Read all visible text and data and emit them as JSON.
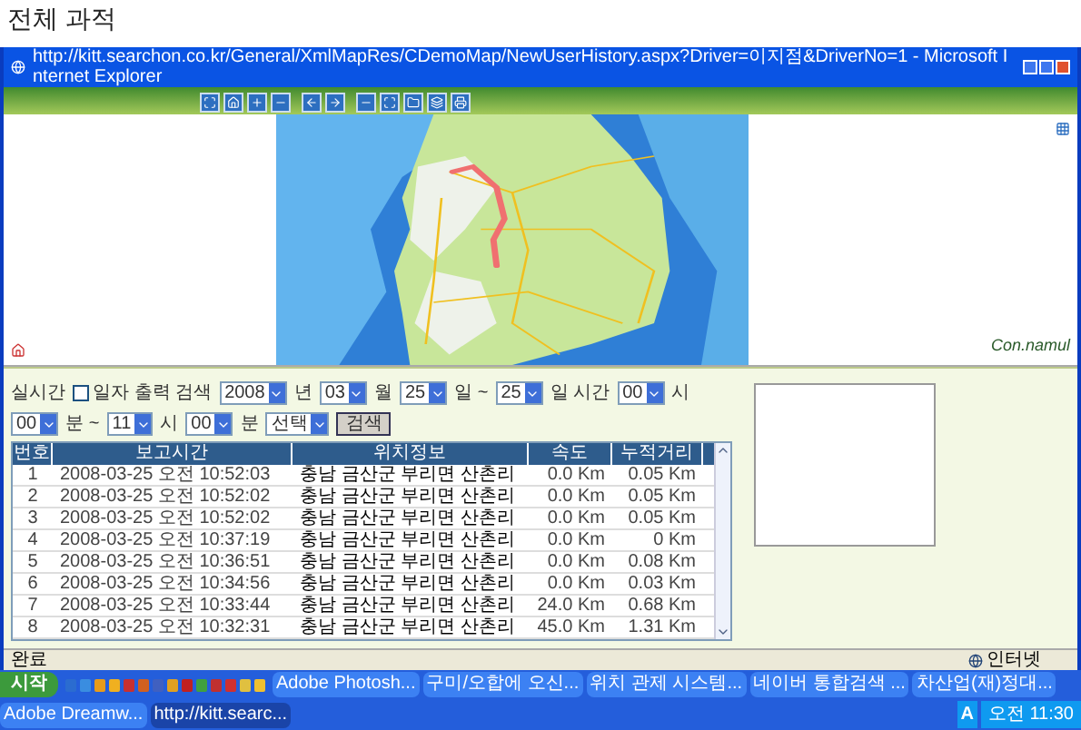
{
  "page_title": "전체 과적",
  "browser": {
    "title": "http://kitt.searchon.co.kr/General/XmlMapRes/CDemoMap/NewUserHistory.aspx?Driver=이지점&DriverNo=1 - Microsoft Internet Explorer"
  },
  "map": {
    "logo": "Con.namul"
  },
  "filter": [
    {
      "kind": "text",
      "label": "실시간"
    },
    {
      "kind": "checkbox",
      "label": "일자 출력 검색",
      "checked": false
    },
    {
      "kind": "select",
      "value": "2008"
    },
    {
      "kind": "text",
      "label": "년"
    },
    {
      "kind": "select",
      "value": "03"
    },
    {
      "kind": "text",
      "label": "월"
    },
    {
      "kind": "select",
      "value": "25"
    },
    {
      "kind": "text",
      "label": "일 ~"
    },
    {
      "kind": "select",
      "value": "25"
    },
    {
      "kind": "text",
      "label": "일 시간"
    },
    {
      "kind": "select",
      "value": "00"
    },
    {
      "kind": "text",
      "label": "시"
    },
    {
      "kind": "select",
      "value": "00"
    },
    {
      "kind": "text",
      "label": "분 ~"
    },
    {
      "kind": "select",
      "value": "11"
    },
    {
      "kind": "text",
      "label": "시"
    },
    {
      "kind": "select",
      "value": "00"
    },
    {
      "kind": "text",
      "label": "분"
    },
    {
      "kind": "select",
      "value": "선택"
    },
    {
      "kind": "button",
      "label": "검색"
    }
  ],
  "table": {
    "columns": [
      "번호",
      "보고시간",
      "위치정보",
      "속도",
      "누적거리"
    ],
    "rows": [
      [
        "1",
        "2008-03-25 오전 10:52:03",
        "충남 금산군 부리면 산촌리",
        "0.0 Km",
        "0.05 Km"
      ],
      [
        "2",
        "2008-03-25 오전 10:52:02",
        "충남 금산군 부리면 산촌리",
        "0.0 Km",
        "0.05 Km"
      ],
      [
        "3",
        "2008-03-25 오전 10:52:02",
        "충남 금산군 부리면 산촌리",
        "0.0 Km",
        "0.05 Km"
      ],
      [
        "4",
        "2008-03-25 오전 10:37:19",
        "충남 금산군 부리면 산촌리",
        "0.0 Km",
        "0 Km"
      ],
      [
        "5",
        "2008-03-25 오전 10:36:51",
        "충남 금산군 부리면 산촌리",
        "0.0 Km",
        "0.08 Km"
      ],
      [
        "6",
        "2008-03-25 오전 10:34:56",
        "충남 금산군 부리면 산촌리",
        "0.0 Km",
        "0.03 Km"
      ],
      [
        "7",
        "2008-03-25 오전 10:33:44",
        "충남 금산군 부리면 산촌리",
        "24.0 Km",
        "0.68 Km"
      ],
      [
        "8",
        "2008-03-25 오전 10:32:31",
        "충남 금산군 부리면 산촌리",
        "45.0 Km",
        "1.31 Km"
      ]
    ]
  },
  "status_bar": {
    "text": "완료",
    "zone": "인터넷"
  },
  "taskbar": {
    "start": "시작",
    "tasks": [
      {
        "label": "Adobe Photosh...",
        "selected": false
      },
      {
        "label": "구미/오합에 오신...",
        "selected": false
      },
      {
        "label": "위치 관제 시스템...",
        "selected": false
      },
      {
        "label": "네이버 통합검색 ...",
        "selected": false
      },
      {
        "label": "차산업(재)정대...",
        "selected": false
      },
      {
        "label": "Adobe Dreamw...",
        "selected": false
      },
      {
        "label": "http://kitt.searc...",
        "selected": true
      }
    ],
    "tray": "A",
    "clock": "오전 11:30"
  }
}
